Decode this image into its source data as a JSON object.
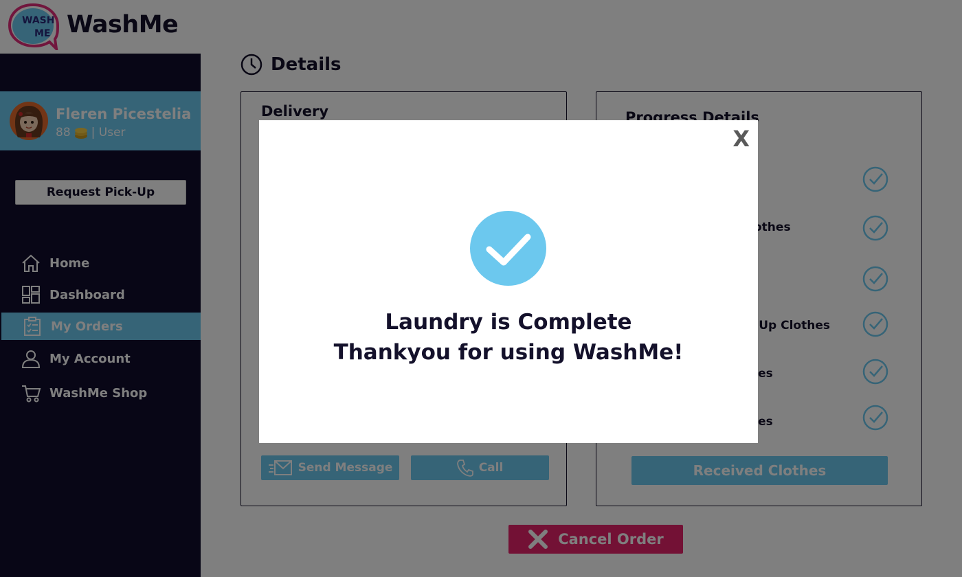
{
  "app": {
    "brand": "WashMe",
    "logo_text": "WASH ME"
  },
  "user": {
    "name": "Fleren Picestelia",
    "points": "88",
    "role": "| User"
  },
  "sidebar": {
    "request_button": "Request Pick-Up",
    "items": [
      {
        "label": "Home",
        "icon": "home-icon"
      },
      {
        "label": "Dashboard",
        "icon": "dashboard-icon"
      },
      {
        "label": "My Orders",
        "icon": "clipboard-icon",
        "active": true
      },
      {
        "label": "My Account",
        "icon": "user-icon"
      },
      {
        "label": "WashMe Shop",
        "icon": "cart-icon"
      }
    ]
  },
  "main": {
    "title": "Details",
    "delivery": {
      "title": "Delivery",
      "send_message_button": "Send Message",
      "call_button": "Call"
    },
    "progress": {
      "title": "Progress Details",
      "visible_steps": [
        "othes",
        "k Up Clothes",
        "hes",
        "hes"
      ],
      "received_button": "Received Clothes"
    },
    "cancel_button": "Cancel Order"
  },
  "modal": {
    "close_label": "X",
    "line1": "Laundry is Complete",
    "line2": "Thankyou for using WashMe!"
  },
  "colors": {
    "navy": "#110d2c",
    "accent_blue": "#6cc8ee",
    "cancel_pink": "#e7236a"
  }
}
